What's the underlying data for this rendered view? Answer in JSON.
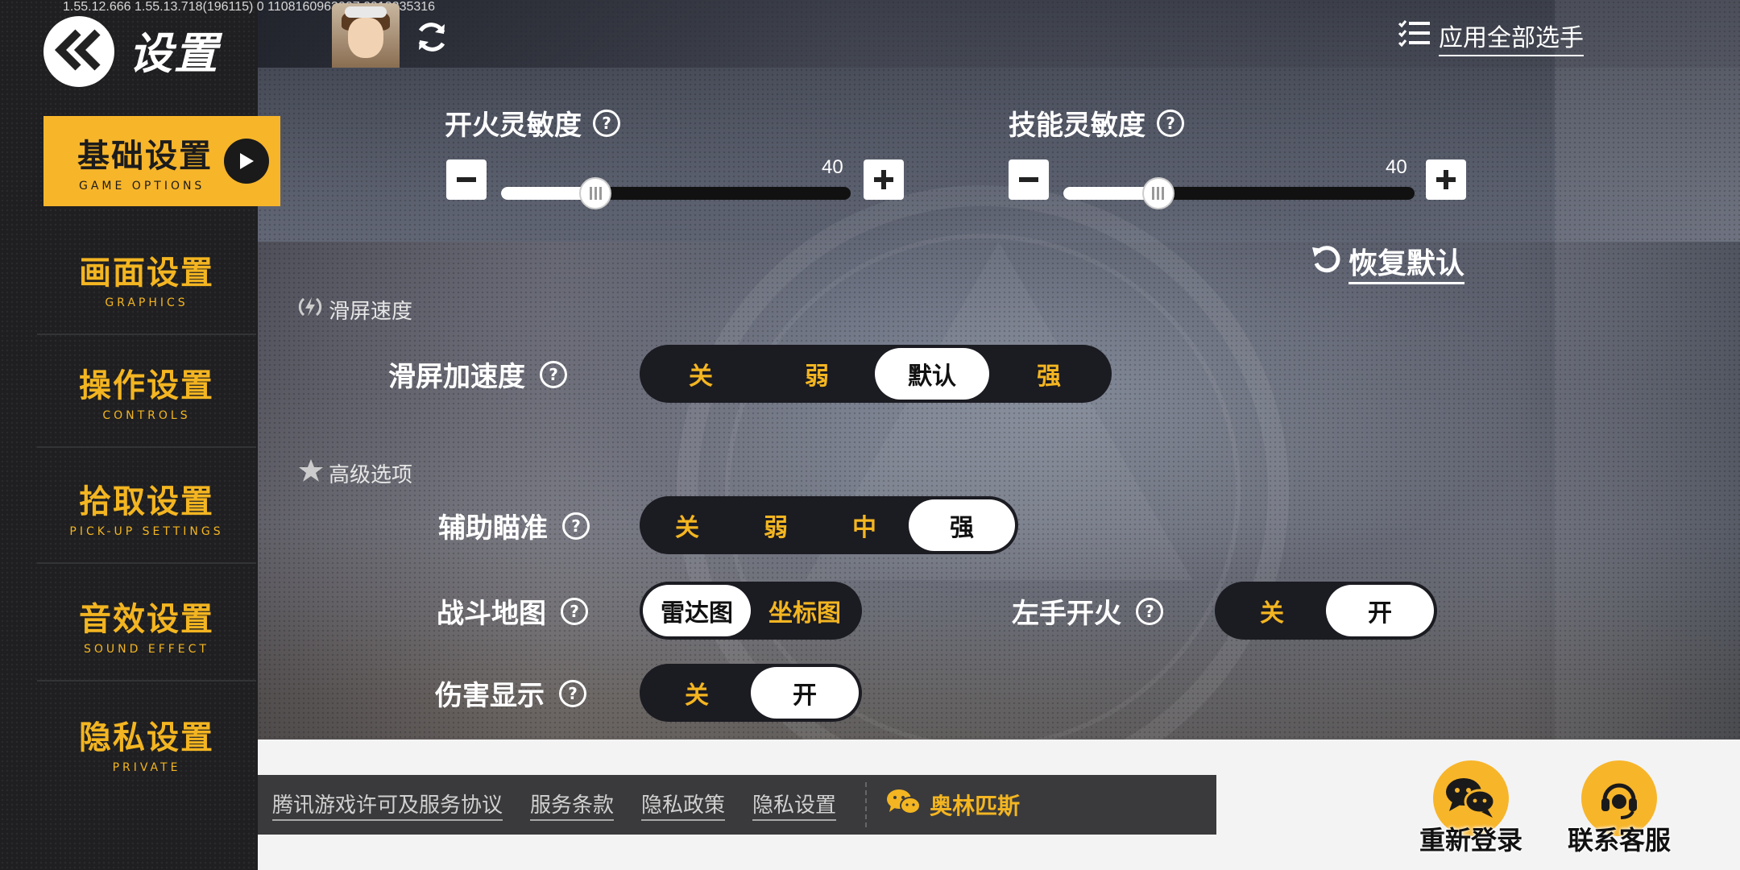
{
  "debug_text": "1.55.12.666  1.55.13.718(196115)  0  1108160963907    0913235316",
  "header": {
    "title": "设置",
    "apply_all_label": "应用全部选手"
  },
  "sidebar": {
    "items": [
      {
        "label": "基础设置",
        "sub": "GAME OPTIONS",
        "active": true
      },
      {
        "label": "画面设置",
        "sub": "GRAPHICS"
      },
      {
        "label": "操作设置",
        "sub": "CONTROLS"
      },
      {
        "label": "拾取设置",
        "sub": "PICK-UP SETTINGS"
      },
      {
        "label": "音效设置",
        "sub": "SOUND EFFECT"
      },
      {
        "label": "隐私设置",
        "sub": "PRIVATE"
      }
    ]
  },
  "sensitivity": {
    "fire": {
      "label": "开火灵敏度",
      "value": "40",
      "fraction": 0.27
    },
    "skill": {
      "label": "技能灵敏度",
      "value": "40",
      "fraction": 0.27
    }
  },
  "reset_label": "恢复默认",
  "sections": {
    "swipe_speed": "滑屏速度",
    "advanced": "高级选项"
  },
  "settings": {
    "swipe_accel": {
      "label": "滑屏加速度",
      "options": [
        "关",
        "弱",
        "默认",
        "强"
      ],
      "selected": "默认"
    },
    "aim_assist": {
      "label": "辅助瞄准",
      "options": [
        "关",
        "弱",
        "中",
        "强"
      ],
      "selected": "强"
    },
    "battle_map": {
      "label": "战斗地图",
      "options": [
        "雷达图",
        "坐标图"
      ],
      "selected": "雷达图"
    },
    "left_fire": {
      "label": "左手开火",
      "options": [
        "关",
        "开"
      ],
      "selected": "开"
    },
    "damage_display": {
      "label": "伤害显示",
      "options": [
        "关",
        "开"
      ],
      "selected": "开"
    }
  },
  "footer": {
    "links": [
      "腾讯游戏许可及服务协议",
      "服务条款",
      "隐私政策",
      "隐私设置"
    ],
    "brand": "奥林匹斯",
    "relogin": "重新登录",
    "support": "联系客服"
  },
  "colors": {
    "accent": "#f7b52a",
    "sidebar_bg": "#1f1f21",
    "segment_bg": "#1b1b22"
  }
}
